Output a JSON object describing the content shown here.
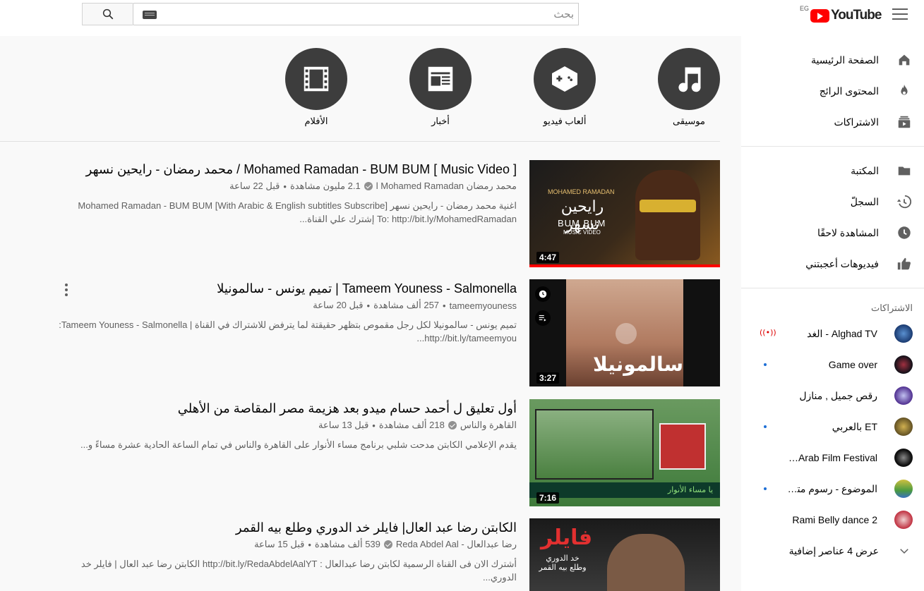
{
  "header": {
    "logo_text": "YouTube",
    "region": "EG",
    "search_placeholder": "بحث"
  },
  "categories": [
    {
      "label": "موسيقى",
      "icon": "music-note-icon"
    },
    {
      "label": "ألعاب فيديو",
      "icon": "gamepad-icon"
    },
    {
      "label": "أخبار",
      "icon": "newspaper-icon"
    },
    {
      "label": "الأفلام",
      "icon": "film-icon"
    }
  ],
  "sidebar": {
    "items": [
      {
        "label": "الصفحة الرئيسية",
        "icon": "home-icon"
      },
      {
        "label": "المحتوى الرائج",
        "icon": "trending-icon"
      },
      {
        "label": "الاشتراكات",
        "icon": "subscriptions-icon"
      },
      {
        "label": "المكتبة",
        "icon": "library-icon"
      },
      {
        "label": "السجلّ",
        "icon": "history-icon"
      },
      {
        "label": "المشاهدة لاحقًا",
        "icon": "watch-later-icon"
      },
      {
        "label": "فيديوهات أعجبتني",
        "icon": "like-icon"
      }
    ],
    "subscriptions_heading": "الاشتراكات",
    "subscriptions": [
      {
        "name": "Alghad TV - الغد",
        "badge": "live"
      },
      {
        "name": "Game over",
        "badge": "dot"
      },
      {
        "name": "رقص جميل , منازل",
        "badge": ""
      },
      {
        "name": "ET بالعربي",
        "badge": "dot"
      },
      {
        "name": "Malmo Arab Film Festival",
        "badge": ""
      },
      {
        "name": "الموضوع - رسوم متحركة",
        "badge": "dot"
      },
      {
        "name": "Rami Belly dance 2",
        "badge": ""
      }
    ],
    "show_more": "عرض 4 عناصر إضافية"
  },
  "videos": [
    {
      "title": "Mohamed Ramadan - BUM BUM [ Music Video ] / محمد رمضان - رايحين نسهر",
      "channel": "محمد رمضان l Mohamed Ramadan",
      "verified": true,
      "views": "2.1 مليون مشاهدة",
      "age": "قبل 22 ساعة",
      "desc_line1": "اغنية محمد رمضان - رايحين نسهر Mohamed Ramadan - BUM BUM [With Arabic & English subtitles Subscribe]",
      "desc_line2": "To: http://bit.ly/MohamedRamadan إشترك علي القناة...",
      "duration": "4:47",
      "thumb_caption": "MOHAMED RAMADAN",
      "thumb_title": "BUM BUM",
      "thumb_sub": "MUSIC VIDEO",
      "thumb_arabic": "رايحين نسهر"
    },
    {
      "title": "Tameem Youness - Salmonella | تميم يونس - سالمونيلا",
      "channel": "tameemyouness",
      "verified": false,
      "views": "257 ألف مشاهدة",
      "age": "قبل 20 ساعة",
      "desc_line1": "تميم يونس - سالمونيلا لكل رجل مقموص بتظهر حقيقتة لما يترفض للاشتراك في القناة | Tameem Youness - Salmonella:",
      "desc_line2": "http://bit.ly/tameemyou...",
      "duration": "3:27",
      "thumb_arabic": "سالمونيلا"
    },
    {
      "title": "أول تعليق ل أحمد حسام ميدو بعد هزيمة مصر المقاصة من الأهلي",
      "channel": "القاهرة والناس",
      "verified": true,
      "views": "218 ألف مشاهدة",
      "age": "قبل 13 ساعة",
      "desc_line1": "يقدم الإعلامي الكابتن مدحت شلبي برنامج مساء الأنوار على القاهرة والناس في تمام الساعة الحادية عشرة مساءً و...",
      "desc_line2": "",
      "duration": "7:16",
      "thumb_banner": "يا مساء الأنوار"
    },
    {
      "title": "الكابتن رضا عبد العال| فايلر خد الدوري وطلع بيه القمر",
      "channel": "رضا عبدالعال - Reda Abdel Aal",
      "verified": true,
      "views": "539 ألف مشاهدة",
      "age": "قبل 15 ساعة",
      "desc_line1": "أشترك الان فى القناة الرسمية لكابتن رضا عبدالعال : http://bit.ly/RedaAbdelAalYT الكابتن رضا عبد العال | فايلر خد الدوري...",
      "desc_line2": "",
      "duration": "",
      "thumb_title": "فايلر",
      "thumb_sub": "خد الدوري وطلع بيه القمر"
    }
  ],
  "colors": {
    "accent": "#ff0000",
    "category_circle": "#3d3d3d",
    "muted_text": "#606060"
  }
}
